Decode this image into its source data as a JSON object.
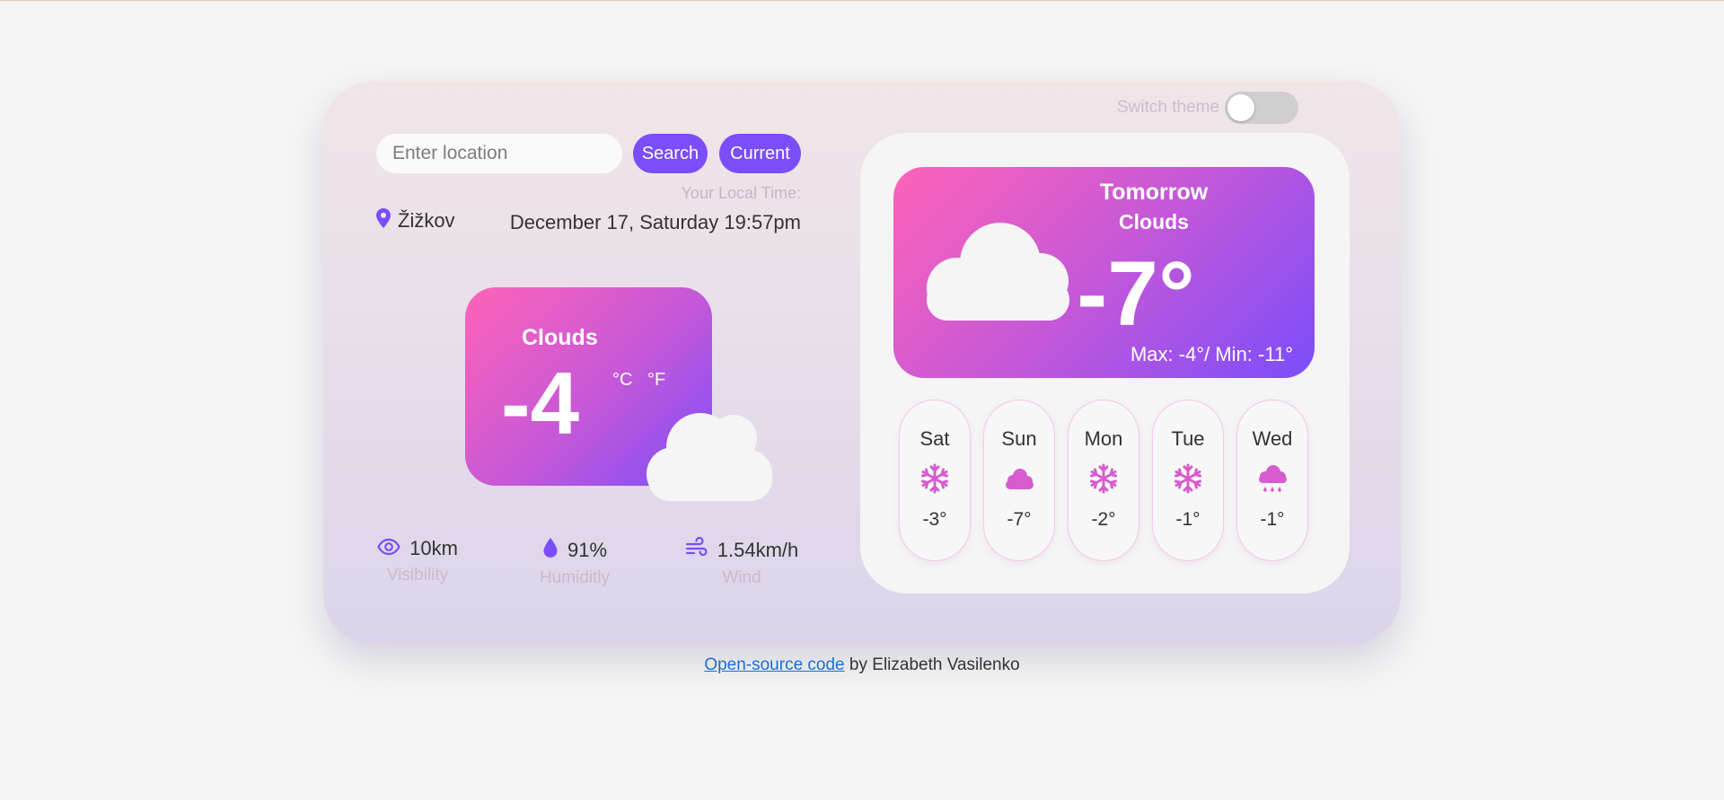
{
  "theme": {
    "label": "Switch theme",
    "enabled": false
  },
  "search": {
    "placeholder": "Enter location",
    "value": "",
    "search_label": "Search",
    "current_label": "Current"
  },
  "local_time_label": "Your Local Time:",
  "location": "Žižkov",
  "datetime": "December 17, Saturday 19:57pm",
  "now": {
    "description": "Clouds",
    "temperature": "-4",
    "unit_c": "°C",
    "unit_f": "°F",
    "icon": "cloud-icon"
  },
  "stats": [
    {
      "icon": "eye-icon",
      "value": "10km",
      "label": "Visibility"
    },
    {
      "icon": "droplet-icon",
      "value": "91%",
      "label": "Humiditly"
    },
    {
      "icon": "wind-icon",
      "value": "1.54km/h",
      "label": "Wind"
    }
  ],
  "tomorrow": {
    "title": "Tomorrow",
    "description": "Clouds",
    "temperature": "-7°",
    "range": "Max: -4°/ Min: -11°",
    "icon": "cloud-icon"
  },
  "days": [
    {
      "name": "Sat",
      "icon": "snowflake-icon",
      "temp": "-3°"
    },
    {
      "name": "Sun",
      "icon": "cloud-icon",
      "temp": "-7°"
    },
    {
      "name": "Mon",
      "icon": "snowflake-icon",
      "temp": "-2°"
    },
    {
      "name": "Tue",
      "icon": "snowflake-icon",
      "temp": "-1°"
    },
    {
      "name": "Wed",
      "icon": "rain-cloud-icon",
      "temp": "-1°"
    }
  ],
  "footer": {
    "link_text": "Open-source code",
    "rest": " by Elizabeth Vasilenko"
  },
  "colors": {
    "accent": "#7b4dfb",
    "pink": "#ff63b8",
    "icon_pink": "#d65cd0",
    "background": "#f5f5f5"
  }
}
